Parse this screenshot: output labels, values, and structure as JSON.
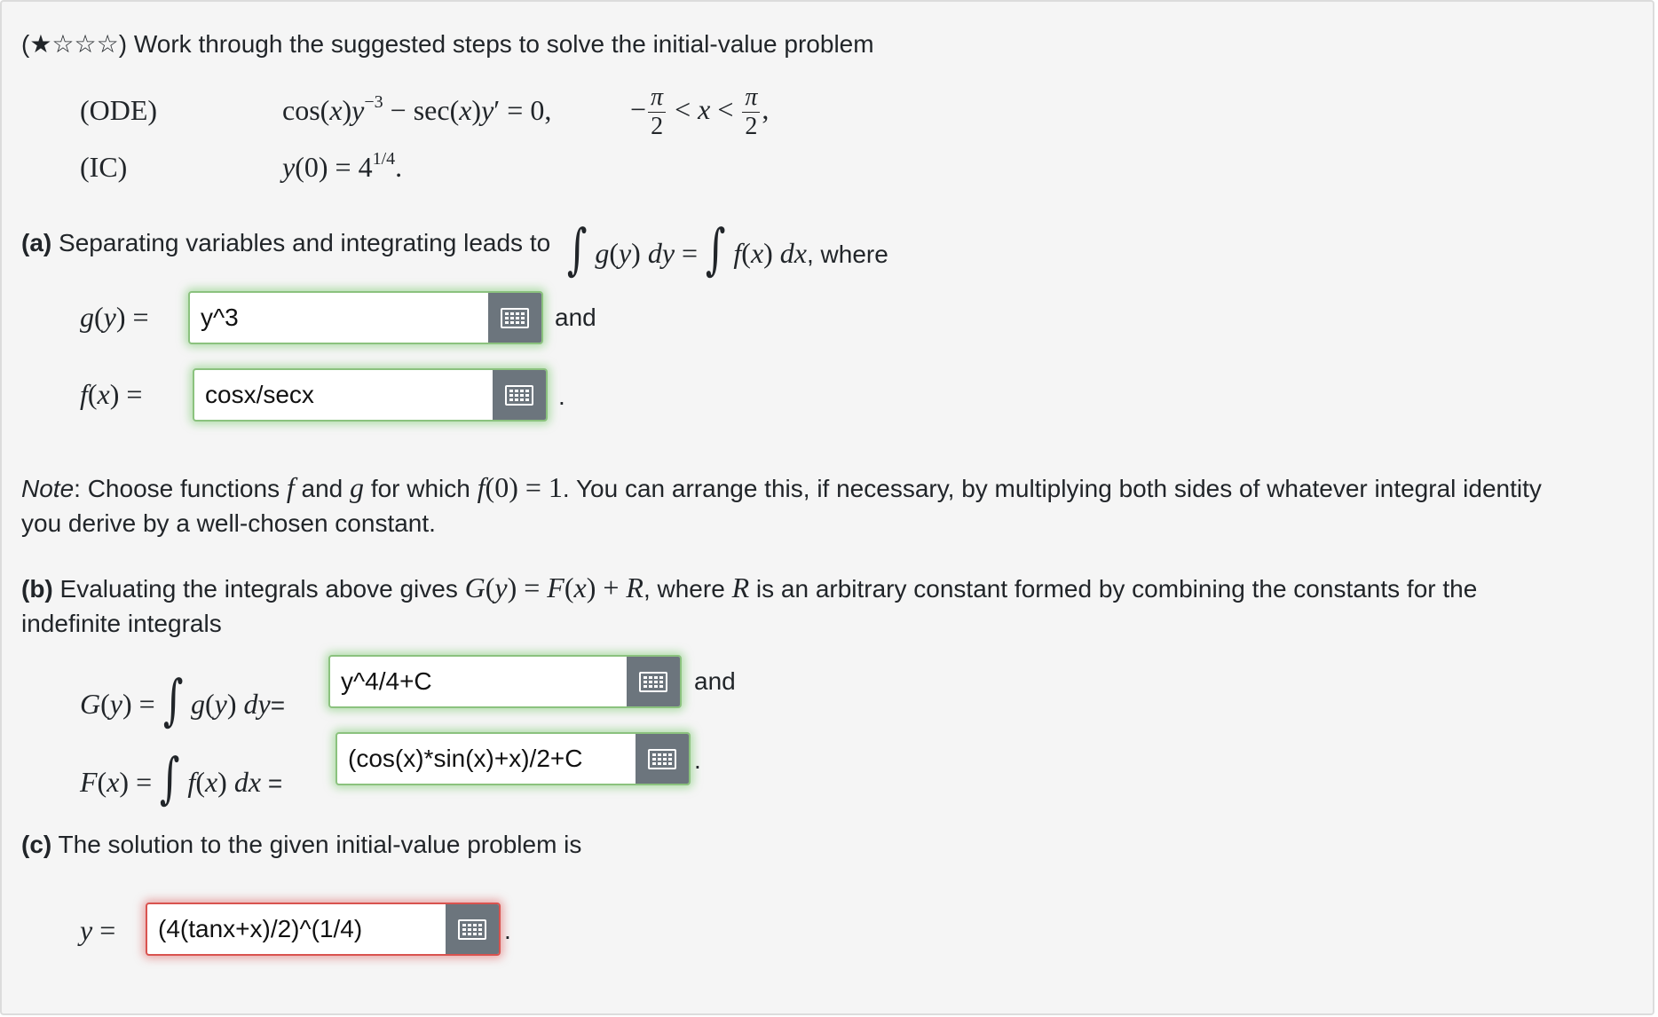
{
  "header": {
    "stars": "(★☆☆☆)",
    "intro": "Work through the suggested steps to solve the initial-value problem"
  },
  "problem": {
    "ode_label": "(ODE)",
    "ic_label": "(IC)"
  },
  "part_a": {
    "label": "(a)",
    "text": "Separating variables and integrating leads to",
    "where": ", where",
    "g_value": "y^3",
    "f_value": "cosx/secx",
    "and_text": "and",
    "period": "."
  },
  "note": {
    "label": "Note",
    "text_1": ": Choose functions",
    "text_2": "and",
    "text_3": "for which",
    "text_4": ". You can arrange this, if necessary, by multiplying both sides of whatever integral identity",
    "text_5": "you derive by a well-chosen constant."
  },
  "part_b": {
    "label": "(b)",
    "text_1": "Evaluating the integrals above gives",
    "text_2": ", where",
    "text_3": "is an arbitrary constant formed by combining the constants for the",
    "text_4": "indefinite integrals",
    "eq_sign": "=",
    "G_value": "y^4/4+C",
    "F_value": "(cos(x)*sin(x)+x)/2+C",
    "and_text": "and",
    "period": "."
  },
  "part_c": {
    "label": "(c)",
    "text": "The solution to the given initial-value problem is",
    "y_value": "(4(tanx+x)/2)^(1/4)",
    "period": "."
  },
  "colors": {
    "correct_border": "#8bc27e",
    "incorrect_border": "#d9534f",
    "palette_button": "#6c757d"
  },
  "icons": {
    "palette": "keypad-grid-icon",
    "star_filled": "★",
    "star_empty": "☆"
  }
}
